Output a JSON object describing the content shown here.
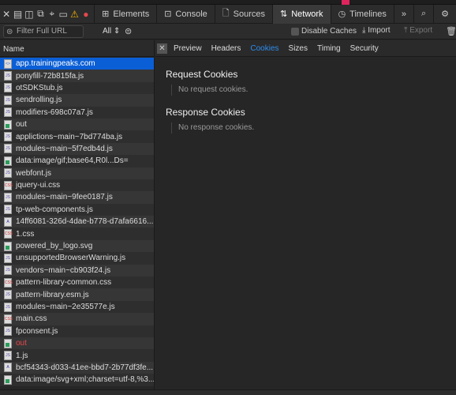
{
  "toolbar": {
    "tabs": [
      {
        "label": "Elements",
        "icon": "elements-icon"
      },
      {
        "label": "Console",
        "icon": "console-icon"
      },
      {
        "label": "Sources",
        "icon": "sources-icon"
      },
      {
        "label": "Network",
        "icon": "network-icon",
        "active": true
      },
      {
        "label": "Timelines",
        "icon": "timelines-icon"
      }
    ],
    "more": "»"
  },
  "filterbar": {
    "placeholder": "Filter Full URL",
    "type_filter": "All",
    "disable_caches": "Disable Caches",
    "import": "Import",
    "export": "Export"
  },
  "list": {
    "header": "Name",
    "items": [
      {
        "name": "app.trainingpeaks.com",
        "type": "doc",
        "selected": true
      },
      {
        "name": "ponyfill-72b815fa.js",
        "type": "js"
      },
      {
        "name": "otSDKStub.js",
        "type": "js"
      },
      {
        "name": "sendrolling.js",
        "type": "js"
      },
      {
        "name": "modifiers-698c07a7.js",
        "type": "js"
      },
      {
        "name": "out",
        "type": "img"
      },
      {
        "name": "applictions~main~7bd774ba.js",
        "type": "js"
      },
      {
        "name": "modules~main~5f7edb4d.js",
        "type": "js"
      },
      {
        "name": "data:image/gif;base64,R0l...Ds=",
        "type": "img"
      },
      {
        "name": "webfont.js",
        "type": "js"
      },
      {
        "name": "jquery-ui.css",
        "type": "css"
      },
      {
        "name": "modules~main~9fee0187.js",
        "type": "js"
      },
      {
        "name": "tp-web-components.js",
        "type": "js"
      },
      {
        "name": "14ff6081-326d-4dae-b778-d7afa6616...",
        "type": "font"
      },
      {
        "name": "1.css",
        "type": "css"
      },
      {
        "name": "powered_by_logo.svg",
        "type": "img"
      },
      {
        "name": "unsupportedBrowserWarning.js",
        "type": "js"
      },
      {
        "name": "vendors~main~cb903f24.js",
        "type": "js"
      },
      {
        "name": "pattern-library-common.css",
        "type": "css"
      },
      {
        "name": "pattern-library.esm.js",
        "type": "js"
      },
      {
        "name": "modules~main~2e35577e.js",
        "type": "js"
      },
      {
        "name": "main.css",
        "type": "css"
      },
      {
        "name": "fpconsent.js",
        "type": "js"
      },
      {
        "name": "out",
        "type": "img",
        "error": true
      },
      {
        "name": "1.js",
        "type": "js"
      },
      {
        "name": "bcf54343-d033-41ee-bbd7-2b77df3fe...",
        "type": "font"
      },
      {
        "name": "data:image/svg+xml;charset=utf-8,%3...",
        "type": "img"
      }
    ]
  },
  "detail": {
    "tabs": [
      "Preview",
      "Headers",
      "Cookies",
      "Sizes",
      "Timing",
      "Security"
    ],
    "active_tab": "Cookies",
    "request_title": "Request Cookies",
    "request_empty": "No request cookies.",
    "response_title": "Response Cookies",
    "response_empty": "No response cookies."
  },
  "colors": {
    "accent": "#0b5fd6",
    "active_tab": "#2d8cf0",
    "error": "#e5484d"
  }
}
